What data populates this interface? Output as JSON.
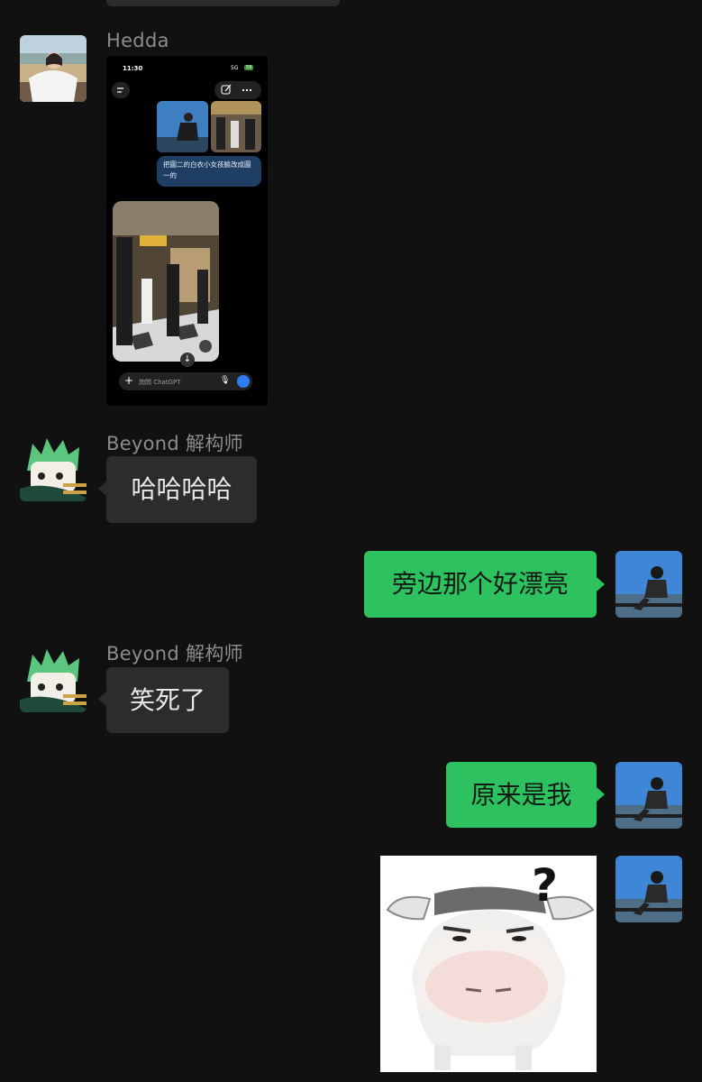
{
  "chat": {
    "messages": [
      {
        "sender": "Hedda",
        "type": "image",
        "image_desc": "phone-screenshot-chatgpt"
      },
      {
        "sender": "Beyond 解构师",
        "type": "text",
        "text": "哈哈哈哈"
      },
      {
        "sender": "me",
        "type": "text",
        "text": "旁边那个好漂亮"
      },
      {
        "sender": "Beyond 解构师",
        "type": "text",
        "text": "笑死了"
      },
      {
        "sender": "me",
        "type": "text",
        "text": "原来是我"
      },
      {
        "sender": "me",
        "type": "sticker",
        "sticker": "confused-cow-sticker",
        "sticker_text": "?"
      }
    ]
  },
  "phone_screenshot": {
    "time": "11:30",
    "signal": "5G",
    "battery": "59",
    "prompt": "把圖二的白衣小女孩臉改成圖一的",
    "input_placeholder": "詢問 ChatGPT"
  },
  "colors": {
    "background": "#111111",
    "bubble_left": "#2c2c2c",
    "bubble_right": "#2ec15f",
    "sender_name": "#8c8c8c"
  }
}
